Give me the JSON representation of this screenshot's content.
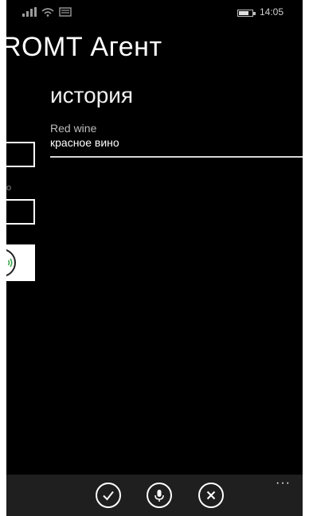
{
  "status_bar": {
    "time": "14:05"
  },
  "app": {
    "title": "ROMT Агент"
  },
  "pivot": {
    "header": "история"
  },
  "history": [
    {
      "source": "Red wine",
      "target": "красное вино"
    }
  ],
  "left_pane": {
    "small_label": "о"
  },
  "app_bar": {
    "more": "···",
    "buttons": [
      "check-icon",
      "microphone-icon",
      "cancel-icon"
    ]
  },
  "colors": {
    "background": "#000000",
    "app_bar": "#1f1f1f",
    "foreground": "#ffffff"
  }
}
